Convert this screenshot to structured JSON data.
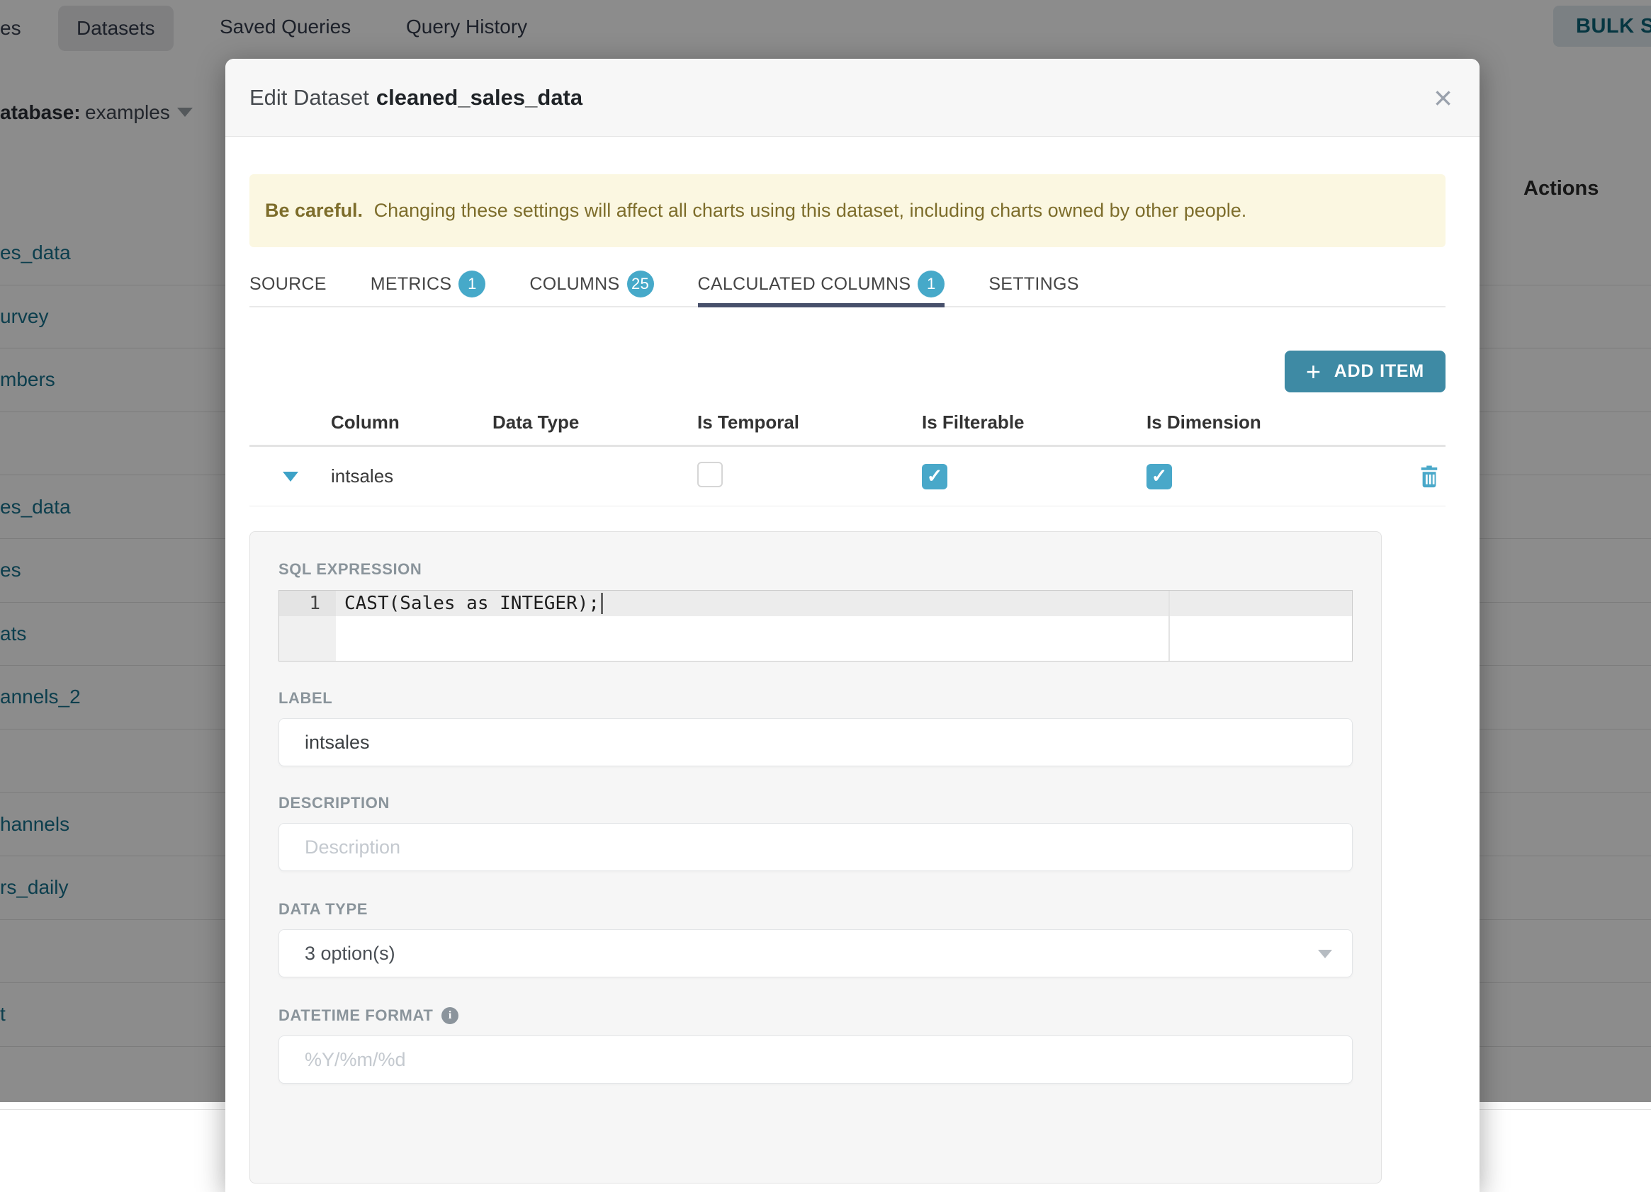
{
  "background": {
    "nav": {
      "fragment": "es",
      "tabs": [
        "Datasets",
        "Saved Queries",
        "Query History"
      ],
      "active_tab": "Datasets",
      "bulk_select": "BULK SELECT"
    },
    "toolbar": {
      "database_label": "atabase:",
      "database_value": "examples"
    },
    "table": {
      "actions_header": "Actions",
      "rows": [
        "es_data",
        "urvey",
        "mbers",
        "",
        "es_data",
        "es",
        "ats",
        "annels_2",
        "",
        "hannels",
        "rs_daily",
        "",
        "t",
        ""
      ]
    }
  },
  "modal": {
    "title_prefix": "Edit Dataset",
    "title_name": "cleaned_sales_data",
    "close_glyph": "×",
    "warning": {
      "bold": "Be careful.",
      "text": "Changing these settings will affect all charts using this dataset, including charts owned by other people."
    },
    "tabs": [
      {
        "label": "SOURCE"
      },
      {
        "label": "METRICS",
        "badge": "1"
      },
      {
        "label": "COLUMNS",
        "badge": "25"
      },
      {
        "label": "CALCULATED COLUMNS",
        "badge": "1",
        "active": true
      },
      {
        "label": "SETTINGS"
      }
    ],
    "add_item": {
      "plus": "+",
      "label": "ADD ITEM"
    },
    "table": {
      "headers": [
        "Column",
        "Data Type",
        "Is Temporal",
        "Is Filterable",
        "Is Dimension"
      ],
      "row": {
        "name": "intsales",
        "is_temporal": false,
        "is_filterable": true,
        "is_dimension": true
      }
    },
    "panel": {
      "sql_label": "SQL EXPRESSION",
      "sql_line": "1",
      "sql_code": "CAST(Sales as INTEGER);",
      "label_label": "LABEL",
      "label_value": "intsales",
      "description_label": "DESCRIPTION",
      "description_placeholder": "Description",
      "datatype_label": "DATA TYPE",
      "datatype_value": "3 option(s)",
      "datetime_label": "DATETIME FORMAT",
      "info_glyph": "i",
      "datetime_placeholder": "%Y/%m/%d"
    }
  },
  "colors": {
    "accent_teal": "#46a9c9",
    "button_teal": "#3e8aa4",
    "link_teal": "#16718c",
    "active_tab_underline": "#47506b",
    "warning_bg": "#fbf7e1",
    "warning_text": "#7d6d2b",
    "overlay": "rgba(0,0,0,0.45)"
  }
}
